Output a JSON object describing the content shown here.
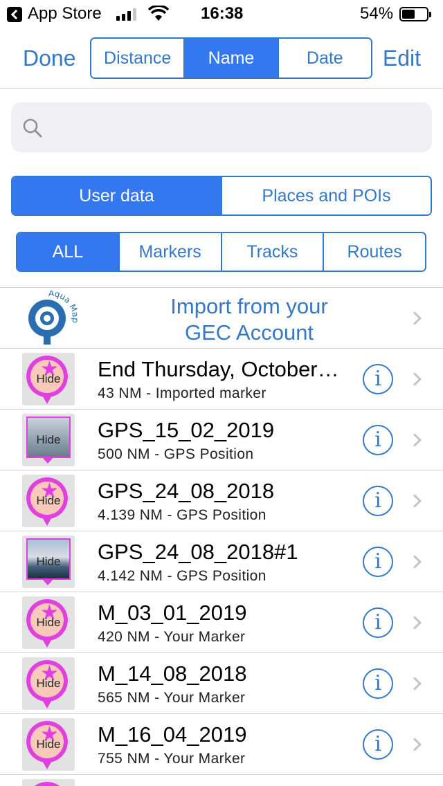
{
  "status_bar": {
    "back_app": "App Store",
    "time": "16:38",
    "battery_pct": "54%",
    "signal_bars": 3,
    "battery_level": 0.54
  },
  "nav": {
    "done": "Done",
    "edit": "Edit",
    "sort_segments": [
      "Distance",
      "Name",
      "Date"
    ],
    "sort_selected": "Name"
  },
  "search": {
    "value": "",
    "placeholder": ""
  },
  "source_segments": [
    "User data",
    "Places and POIs"
  ],
  "source_selected": "User data",
  "type_segments": [
    "ALL",
    "Markers",
    "Tracks",
    "Routes"
  ],
  "type_selected": "ALL",
  "import_row": {
    "line1": "Import from your",
    "line2": "GEC Account",
    "logo_text": "Aqua Map"
  },
  "items": [
    {
      "title": "End Thursday, October…",
      "subtitle": "43 NM - Imported marker",
      "thumb": "marker",
      "thumb_label": "Hide"
    },
    {
      "title": "GPS_15_02_2019",
      "subtitle": "500 NM - GPS Position",
      "thumb": "photo",
      "thumb_label": "Hide"
    },
    {
      "title": "GPS_24_08_2018",
      "subtitle": "4.139 NM - GPS Position",
      "thumb": "marker",
      "thumb_label": "Hide"
    },
    {
      "title": "GPS_24_08_2018#1",
      "subtitle": "4.142 NM - GPS Position",
      "thumb": "photo-beach",
      "thumb_label": "Hide"
    },
    {
      "title": "M_03_01_2019",
      "subtitle": "420 NM - Your Marker",
      "thumb": "marker",
      "thumb_label": "Hide"
    },
    {
      "title": "M_14_08_2018",
      "subtitle": "565 NM - Your Marker",
      "thumb": "marker",
      "thumb_label": "Hide"
    },
    {
      "title": "M_16_04_2019",
      "subtitle": "755 NM - Your Marker",
      "thumb": "marker",
      "thumb_label": "Hide"
    }
  ],
  "colors": {
    "accent": "#3478c8",
    "segment_active": "#3478f0",
    "marker": "#e040e0"
  },
  "icons": {
    "search": "search-icon",
    "info": "info-icon",
    "chevron": "chevron-right-icon"
  }
}
